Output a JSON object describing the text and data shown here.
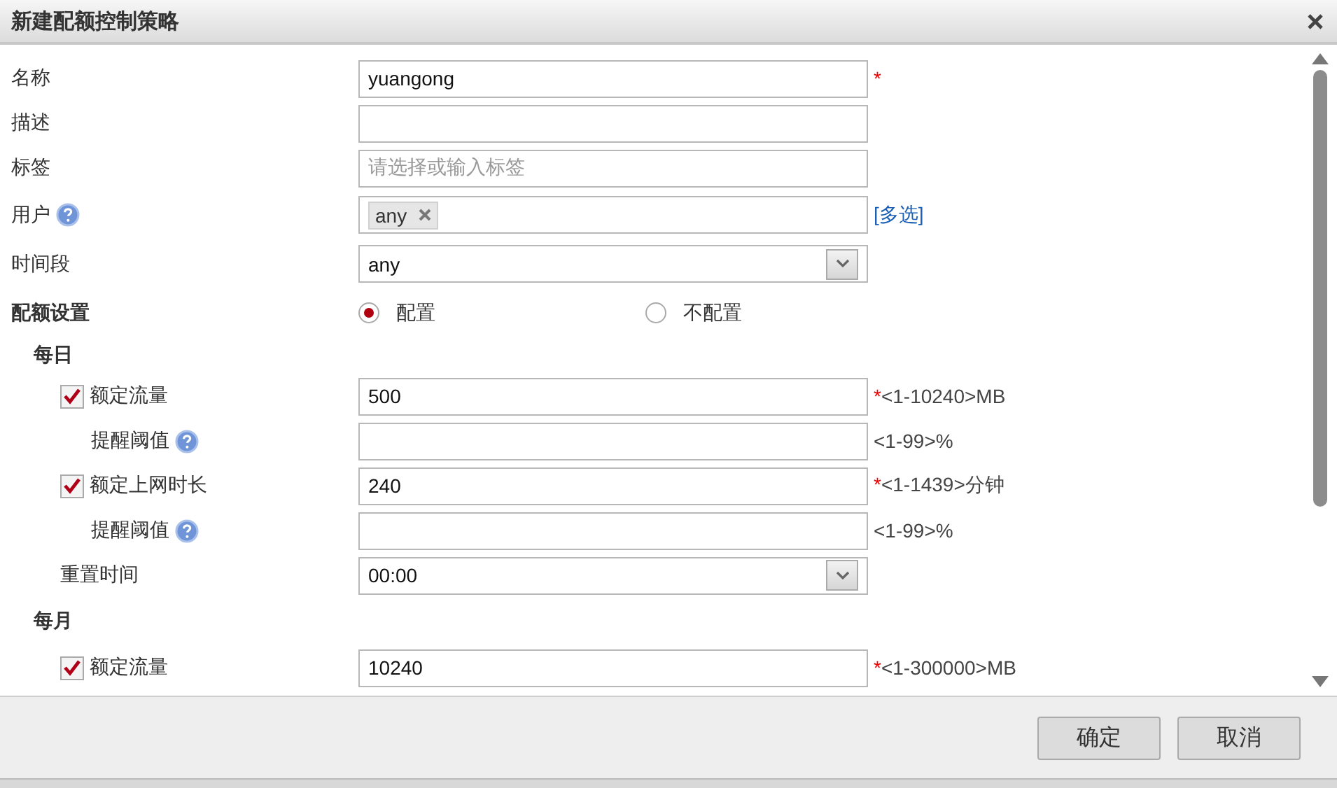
{
  "dialog": {
    "title": "新建配额控制策略"
  },
  "fields": [
    {
      "kind": "text",
      "label": "名称",
      "value": "yuangong",
      "mark": "*"
    },
    {
      "kind": "text",
      "label": "描述"
    },
    {
      "kind": "text",
      "label": "标签",
      "placeholder": "请选择或输入标签"
    },
    {
      "kind": "tags",
      "label": "用户",
      "help": true,
      "tags": [
        "any"
      ],
      "link": "[多选]"
    },
    {
      "kind": "select",
      "label": "时间段",
      "value": "any"
    }
  ],
  "quota": {
    "label": "配额设置",
    "options": [
      {
        "label": "配置",
        "selected": true
      },
      {
        "label": "不配置",
        "selected": false
      }
    ]
  },
  "periods": [
    {
      "title": "每日",
      "items": [
        {
          "kind": "check",
          "label": "额定流量",
          "checked": true,
          "value": "500",
          "mark": "*",
          "hint": "<1-10240>MB"
        },
        {
          "kind": "sub",
          "label": "提醒阈值",
          "help": true,
          "hint": "<1-99>%"
        },
        {
          "kind": "check",
          "label": "额定上网时长",
          "checked": true,
          "value": "240",
          "mark": "*",
          "hint": "<1-1439>分钟"
        },
        {
          "kind": "sub",
          "label": "提醒阈值",
          "help": true,
          "hint": "<1-99>%"
        },
        {
          "kind": "select",
          "label": "重置时间",
          "value": "00:00"
        }
      ]
    },
    {
      "title": "每月",
      "items": [
        {
          "kind": "check",
          "label": "额定流量",
          "checked": true,
          "value": "10240",
          "mark": "*",
          "hint": "<1-300000>MB"
        }
      ]
    }
  ],
  "buttons": [
    "确定",
    "取消"
  ]
}
